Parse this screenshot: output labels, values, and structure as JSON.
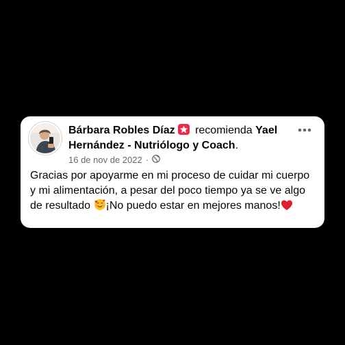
{
  "post": {
    "author_name": "Bárbara Robles Díaz",
    "action_text": "recomienda",
    "page_name": "Yael Hernández - Nutriólogo y Coach",
    "header_end": ".",
    "date": "16 de nov de 2022",
    "separator": "·",
    "privacy_icon": "globe-icon",
    "more_icon": "more-options-icon",
    "recommend_badge_icon": "recommend-star-icon",
    "text_part1": "Gracias por apoyarme en mi proceso de cuidar mi cuerpo y mi alimentación, a pesar del poco tiempo ya se ve algo de resultado",
    "emoji_1": "smiling-face-with-hearts-emoji",
    "text_part2": "¡No puedo estar en mejores manos!",
    "emoji_2": "red-heart-emoji"
  },
  "colors": {
    "background": "#000000",
    "card": "#ffffff",
    "badge": "#f02849",
    "secondary_text": "#65676b"
  }
}
